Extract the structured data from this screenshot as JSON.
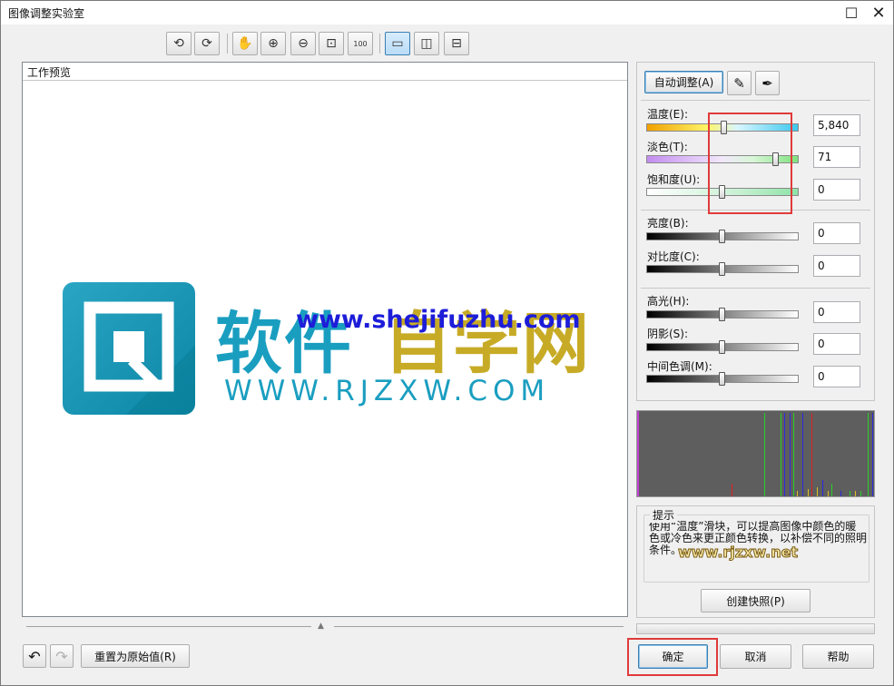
{
  "window": {
    "title": "图像调整实验室"
  },
  "toolbar": {
    "rotate_left": "⟲",
    "rotate_right": "⟳",
    "pan": "✋",
    "zoom_in": "⊕",
    "zoom_out": "⊖",
    "fit": "⊡",
    "actual_size": "100",
    "view_single": "▭",
    "view_split_v": "◫",
    "view_split_h": "⊟"
  },
  "preview": {
    "label": "工作预览",
    "logo_cn1": "软件",
    "logo_cn2": "自学网",
    "logo_en": "WWW.RJZXW.COM",
    "overlay_url": "www.shejifuzhu.com"
  },
  "panel": {
    "auto_adjust": "自动调整(A)",
    "sliders": [
      {
        "label": "温度(E):",
        "value": "5,840",
        "level": 0.51
      },
      {
        "label": "淡色(T):",
        "value": "71",
        "level": 0.85
      },
      {
        "label": "饱和度(U):",
        "value": "0",
        "level": 0.5
      },
      {
        "label": "亮度(B):",
        "value": "0",
        "level": 0.5
      },
      {
        "label": "对比度(C):",
        "value": "0",
        "level": 0.5
      },
      {
        "label": "高光(H):",
        "value": "0",
        "level": 0.5
      },
      {
        "label": "阴影(S):",
        "value": "0",
        "level": 0.5
      },
      {
        "label": "中间色调(M):",
        "value": "0",
        "level": 0.5
      }
    ]
  },
  "hint": {
    "legend": "提示",
    "text": "使用“温度”滑块，可以提高图像中颜色的暖色或冷色来更正颜色转换，以补偿不同的照明条件。",
    "watermark": "www.rjzxw.net",
    "snapshot_button": "创建快照(P)"
  },
  "bottom": {
    "undo_icon": "↶",
    "redo_icon": "↷",
    "reset_button": "重置为原始值(R)",
    "ok_button": "确定",
    "cancel_button": "取消",
    "help_button": "帮助"
  }
}
